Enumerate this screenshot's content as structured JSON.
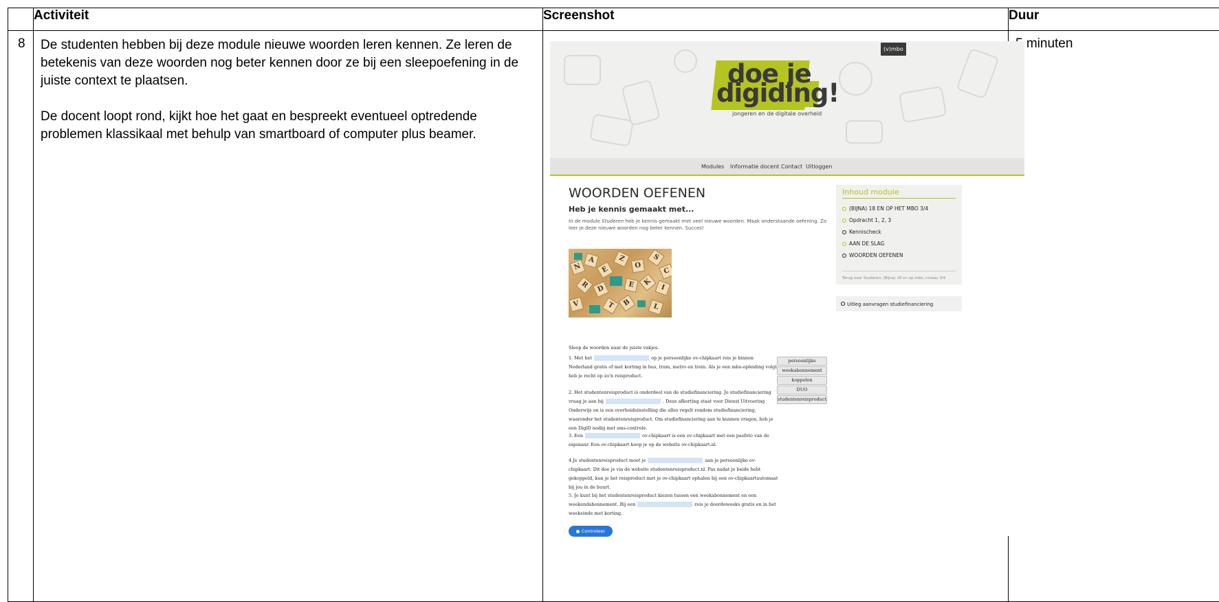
{
  "table": {
    "headers": {
      "activity": "Activiteit",
      "screenshot": "Screenshot",
      "duration": "Duur"
    },
    "row": {
      "number": "8",
      "activity_p1": "De studenten hebben bij deze module nieuwe woorden leren kennen. Ze leren de betekenis van deze woorden nog beter kennen door ze bij een sleepoefening in de juiste context te plaatsen.",
      "activity_p2": "De docent loopt rond, kijkt hoe het gaat en bespreekt eventueel optredende problemen klassikaal met behulp van smartboard of computer plus beamer.",
      "duration": "5 minuten"
    }
  },
  "screenshot": {
    "badge": "(v)mbo",
    "logo_line1": "doe je",
    "logo_line2": "digiding!",
    "logo_subtitle": "jongeren en de digitale overheid",
    "nav": [
      "Modules",
      "Informatie docent",
      "Contact",
      "Uitloggen"
    ],
    "title": "WOORDEN OEFENEN",
    "subtitle": "Heb je kennis gemaakt met...",
    "intro_before": "In de module ",
    "intro_em": "Studeren",
    "intro_after": " heb je kennis gemaakt met veel nieuwe woorden. Maak onderstaande oefening. Zo leer je deze nieuwe woorden nog beter kennen. Succes!",
    "tiles": [
      "N",
      "A",
      "E",
      "Z",
      "O",
      "S",
      "R",
      "D",
      "E",
      "K",
      "I",
      "V",
      "T",
      "B",
      "L",
      "C"
    ],
    "sidebar": {
      "title": "Inhoud module",
      "items": [
        "(BIJNA) 18 EN OP HET MBO 3/4",
        "Opdracht 1, 2, 3",
        "Kennischeck",
        "AAN DE SLAG",
        "WOORDEN OEFENEN"
      ],
      "footer": "Terug naar Studeren: (Bijna) 18 en op mbo, niveau 3/4",
      "link": "Uitleg aanvragen studiefinanciering"
    },
    "exercise": {
      "instruction": "Sleep de woorden naar de juiste vakjes.",
      "q1a": "1. Met het",
      "q1b": "op je persoonlijke ov-chipkaart reis je binnen Nederland gratis of met korting in bus, tram, metro en trein. Als je een mbo-opleiding volgt, heb je recht op zo'n reisproduct.",
      "q2a": "2. Het studentenreisproduct is onderdeel van de studiefinanciering. Je studiefinanciering vraag je aan bij",
      "q2b": ". Deze afkorting staat voor Dienst Uitvoering Onderwijs en is een overheidsinstelling die alles regelt rondom studiefinanciering, waaronder het studentenreisproduct. Om studiefinanciering aan te kunnen vragen, heb je een DigiD nodig met sms-controle.",
      "q3a": "3. Een",
      "q3b": "ov-chipkaart is een ov-chipkaart met een pasfoto van de eigenaar. Een ov-chipkaart koop je op de website ov-chipkaart.nl.",
      "q4a": "4.Je studentenreisproduct moet je",
      "q4b": "aan je persoonlijke ov-chipkaart. Dit doe je via de website studentenreisproduct.nl. Pas nadat je beide hebt gekoppeld, kun je het reisproduct met je ov-chipkaart ophalen bij een ov-chipkaartautomaat bij jou in de buurt.",
      "q5a": "5. Je kunt bij het studentenreisproduct kiezen tussen een weekabonnement en een weekendabonnement. Bij een",
      "q5b": "reis je doordeweeks gratis en in het weekeinde met korting.",
      "words": [
        "persoonlijke",
        "weekabonnement",
        "koppelen",
        "DUO",
        "studentenreisproduct"
      ],
      "check_label": "Controleer"
    }
  }
}
